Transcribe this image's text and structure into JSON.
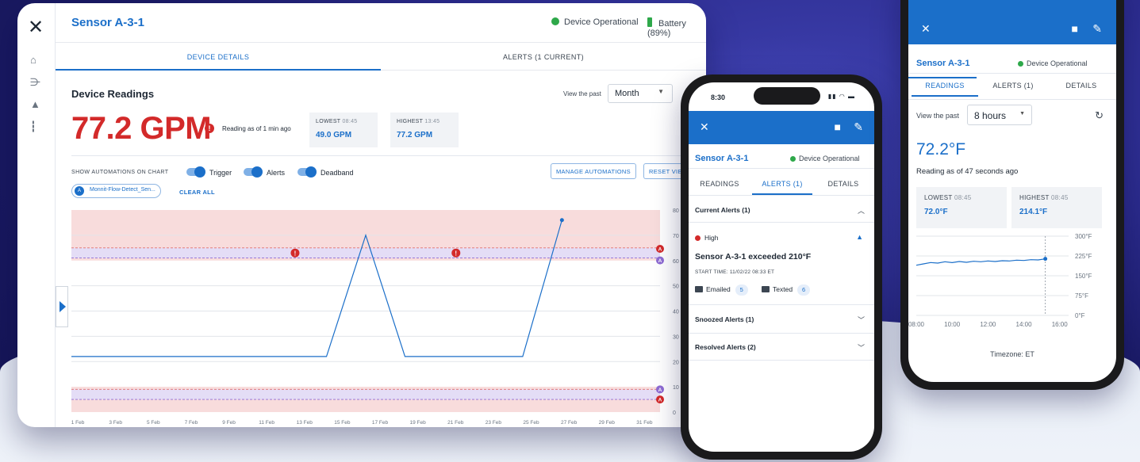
{
  "desktop": {
    "title": "Sensor A-3-1",
    "status": "Device Operational",
    "battery": "Battery (89%)",
    "tabs": [
      "DEVICE DETAILS",
      "ALERTS (1 CURRENT)"
    ],
    "readings_heading": "Device Readings",
    "view_past_label": "View the past",
    "view_past_value": "Month",
    "current_value": "77.2 GPM",
    "reading_as_of": "Reading as of 1 min ago",
    "lowest": {
      "label": "LOWEST",
      "time": "08:45",
      "value": "49.0 GPM"
    },
    "highest": {
      "label": "HIGHEST",
      "time": "13:45",
      "value": "77.2 GPM"
    },
    "show_automations_label": "SHOW AUTOMATIONS ON CHART",
    "toggles": [
      {
        "label": "Trigger",
        "on": true
      },
      {
        "label": "Alerts",
        "on": true
      },
      {
        "label": "Deadband",
        "on": true
      }
    ],
    "buttons": {
      "manage": "MANAGE AUTOMATIONS",
      "reset": "RESET VIE"
    },
    "filter_chip": {
      "avatar": "A",
      "label": "Monnit-Flow-Detect_Sen..."
    },
    "clear_all": "CLEAR ALL"
  },
  "chart_data": {
    "type": "line",
    "x": [
      "1 Feb",
      "3 Feb",
      "5 Feb",
      "7 Feb",
      "9 Feb",
      "11 Feb",
      "13 Feb",
      "15 Feb",
      "17 Feb",
      "19 Feb",
      "21 Feb",
      "23 Feb",
      "25 Feb",
      "27 Feb",
      "29 Feb",
      "31 Feb"
    ],
    "y_ticks": [
      "80",
      "70",
      "60",
      "50",
      "40",
      "30",
      "20",
      "10",
      "0"
    ],
    "ylim": [
      0,
      80
    ],
    "series": [
      {
        "points": [
          [
            0,
            22
          ],
          [
            13,
            22
          ],
          [
            15,
            70
          ],
          [
            17,
            22
          ],
          [
            23,
            22
          ],
          [
            25,
            76
          ]
        ]
      }
    ],
    "alert_band_upper": [
      60,
      80
    ],
    "alert_band_lower": [
      0,
      10
    ],
    "deadband_upper": [
      61,
      65
    ],
    "deadband_lower": [
      5,
      9
    ],
    "gridlines": [
      20,
      30,
      40,
      50,
      70
    ],
    "alert_markers_x": [
      11.4,
      19.6
    ],
    "current_x": 25,
    "colors": {
      "line": "#1b6fc9",
      "alert_band": "#f8dcdc",
      "deadband": "#e4ddf6",
      "alert": "#d32a2a",
      "deadband_marker": "#8e6bd3"
    }
  },
  "phone1": {
    "time": "8:30",
    "title": "Sensor A-3-1",
    "status": "Device Operational",
    "tabs": [
      "READINGS",
      "ALERTS (1)",
      "DETAILS"
    ],
    "current_alerts": "Current Alerts (1)",
    "severity": "High",
    "alert_title": "Sensor A-3-1 exceeded 210°F",
    "start_time": "START TIME: 11/02/22 08:33 ET",
    "emailed_label": "Emailed",
    "emailed_count": "5",
    "texted_label": "Texted",
    "texted_count": "6",
    "snoozed": "Snoozed Alerts (1)",
    "resolved": "Resolved Alerts (2)"
  },
  "phone2": {
    "title": "Sensor A-3-1",
    "status": "Device Operational",
    "tabs": [
      "READINGS",
      "ALERTS (1)",
      "DETAILS"
    ],
    "view_past_label": "View the past",
    "view_past_value": "8 hours",
    "temperature": "72.2°F",
    "reading_as_of": "Reading as of 47 seconds ago",
    "lowest": {
      "label": "LOWEST",
      "time": "08:45",
      "value": "72.0°F"
    },
    "highest": {
      "label": "HIGHEST",
      "time": "08:45",
      "value": "214.1°F"
    },
    "timezone": "Timezone: ET"
  },
  "chart_data_2": {
    "type": "line",
    "x_ticks": [
      "08:00",
      "10:00",
      "12:00",
      "14:00",
      "16:00"
    ],
    "y_ticks": [
      "300°F",
      "225°F",
      "150°F",
      "75°F",
      "0°F"
    ],
    "ylim": [
      0,
      300
    ],
    "xlim": [
      8,
      16.5
    ],
    "values_x": [
      8,
      8.4,
      8.8,
      9.2,
      9.6,
      10,
      10.4,
      10.8,
      11.2,
      11.6,
      12,
      12.4,
      12.8,
      13.2,
      13.6,
      14,
      14.4,
      14.8,
      15.2
    ],
    "values_y": [
      190,
      195,
      200,
      198,
      203,
      200,
      204,
      201,
      205,
      203,
      206,
      204,
      207,
      206,
      209,
      208,
      211,
      210,
      214
    ]
  }
}
